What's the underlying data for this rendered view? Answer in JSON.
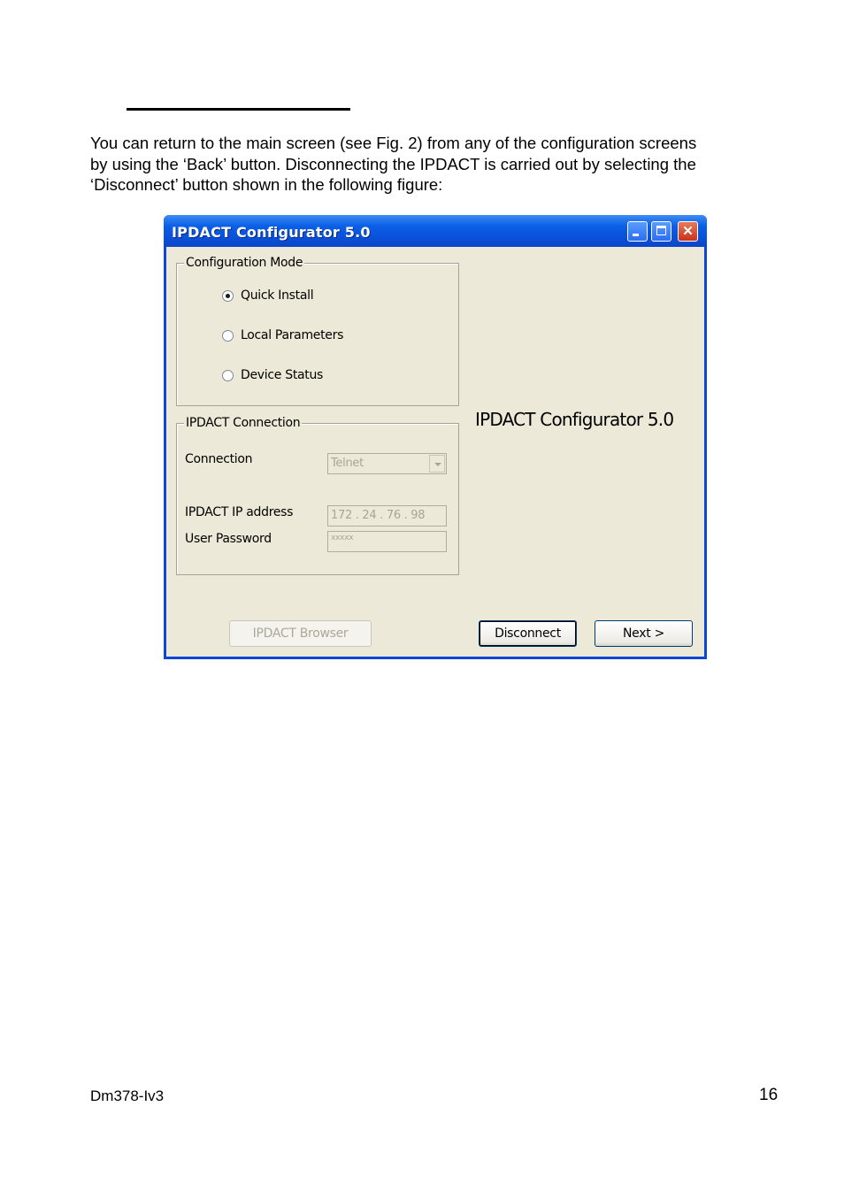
{
  "document": {
    "paragraph_lines": [
      "You can return to the main screen (see Fig.  2) from any of the configuration screens",
      "by using the ‘Back’ button.  Disconnecting the IPDACT is carried out by selecting the",
      "‘Disconnect’ button shown in the following figure:"
    ],
    "footer_left": "Dm378-Iv3",
    "footer_right": "16"
  },
  "window": {
    "title": "IPDACT Configurator 5.0",
    "controls": {
      "minimize": "minimize-icon",
      "maximize": "maximize-icon",
      "close": "close-icon"
    },
    "config_mode": {
      "legend": "Configuration Mode",
      "options": [
        {
          "label": "Quick Install",
          "selected": true
        },
        {
          "label": "Local Parameters",
          "selected": false
        },
        {
          "label": "Device Status",
          "selected": false
        }
      ]
    },
    "connection": {
      "legend": "IPDACT Connection",
      "connection_label": "Connection",
      "connection_value": "Telnet",
      "ip_label": "IPDACT IP address",
      "ip_value": "172 .  24  .  76  .  98",
      "password_label": "User Password",
      "password_value": "xxxxx"
    },
    "product_title": "IPDACT Configurator 5.0",
    "buttons": {
      "browser": "IPDACT Browser",
      "disconnect": "Disconnect",
      "next": "Next >"
    }
  }
}
